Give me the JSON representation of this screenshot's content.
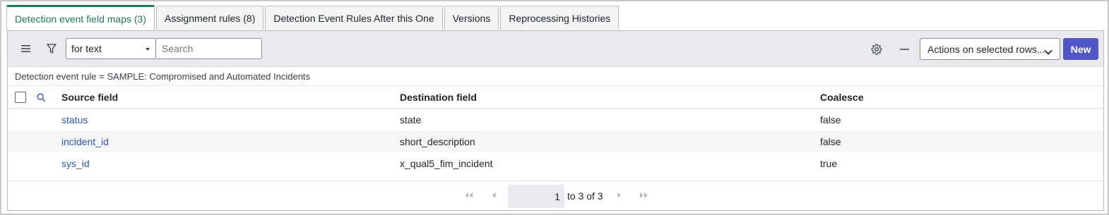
{
  "tabs": [
    {
      "label": "Detection event field maps (3)",
      "active": true
    },
    {
      "label": "Assignment rules (8)",
      "active": false
    },
    {
      "label": "Detection Event Rules After this One",
      "active": false
    },
    {
      "label": "Versions",
      "active": false
    },
    {
      "label": "Reprocessing Histories",
      "active": false
    }
  ],
  "toolbar": {
    "menu_icon": "hamburger-menu-icon",
    "filter_icon": "funnel-icon",
    "search_field_select": "for text",
    "search_placeholder": "Search",
    "settings_icon": "gear-icon",
    "collapse_icon": "minus-icon",
    "actions_select": "Actions on selected rows...",
    "new_label": "New"
  },
  "breadcrumb": "Detection event rule = SAMPLE: Compromised and Automated Incidents",
  "table": {
    "headers": {
      "source": "Source field",
      "destination": "Destination field",
      "coalesce": "Coalesce"
    },
    "rows": [
      {
        "source": "status",
        "destination": "state",
        "coalesce": "false"
      },
      {
        "source": "incident_id",
        "destination": "short_description",
        "coalesce": "false"
      },
      {
        "source": "sys_id",
        "destination": "x_qual5_fim_incident",
        "coalesce": "true"
      }
    ]
  },
  "pagination": {
    "current": "1",
    "range_text": "to 3 of 3"
  },
  "colors": {
    "active_tab": "#1e7a5c",
    "link": "#3056b8",
    "new_button": "#5055c9"
  }
}
